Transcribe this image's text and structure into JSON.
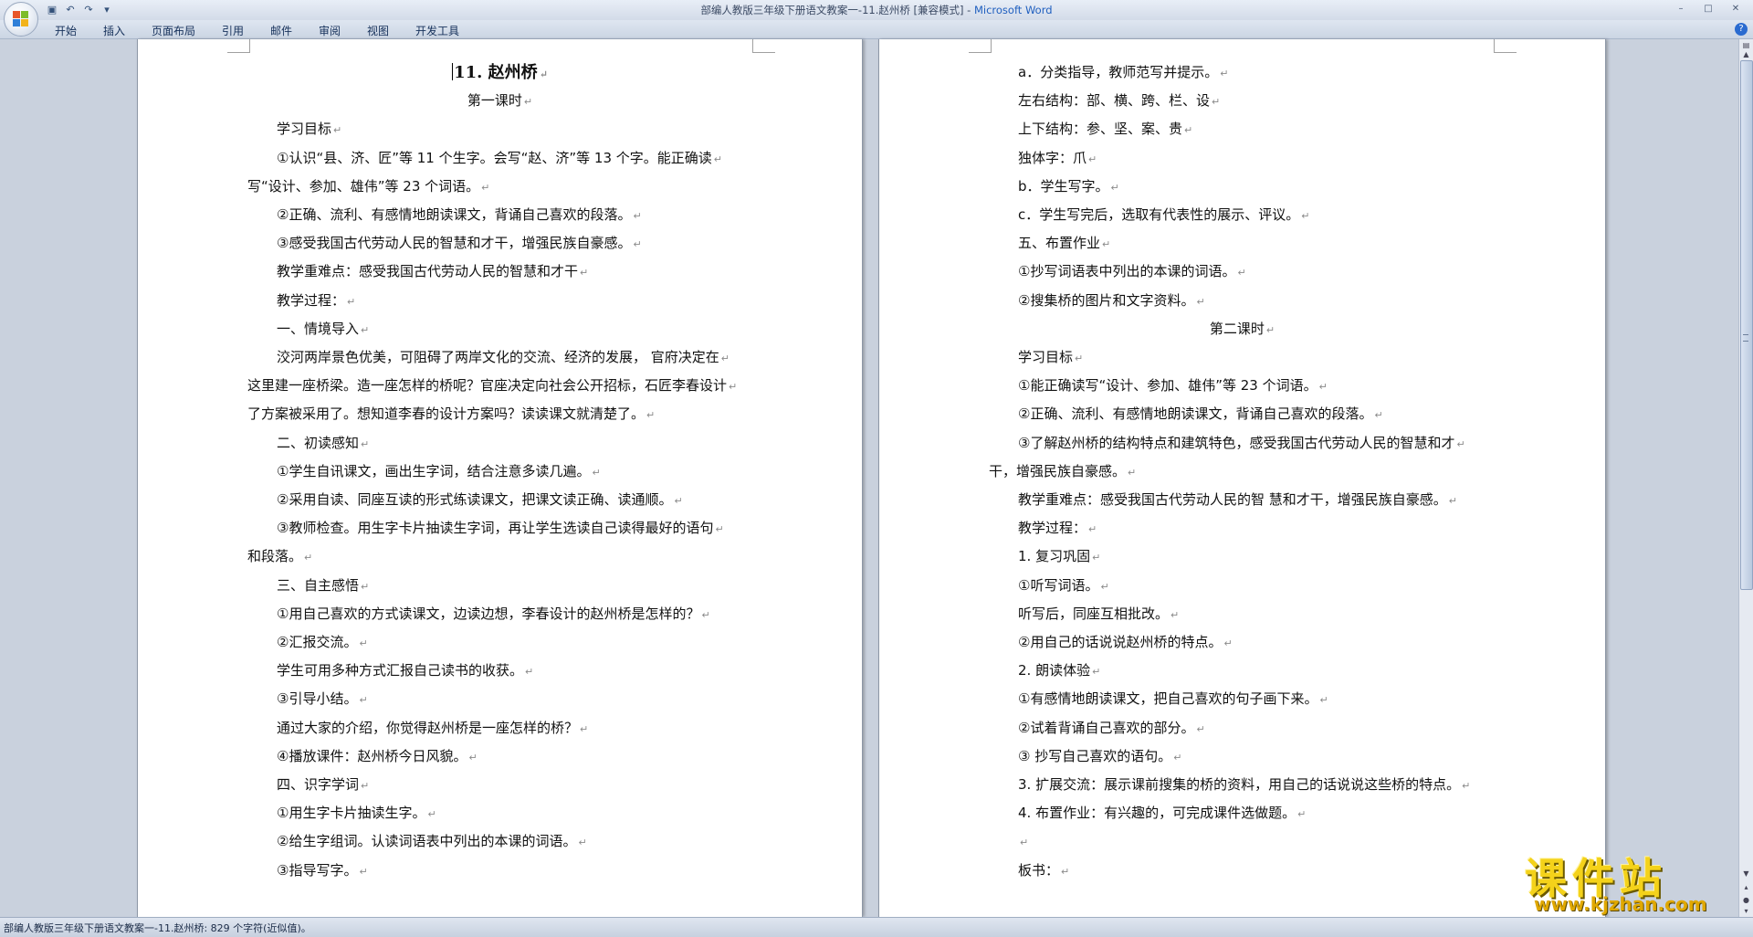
{
  "window": {
    "title_doc": "部编人教版三年级下册语文教案一-11.赵州桥 [兼容模式]",
    "title_sep": " - ",
    "title_app": "Microsoft Word",
    "controls": [
      "–",
      "□",
      "✕"
    ]
  },
  "qat": {
    "items": [
      {
        "icon": "save-icon",
        "glyph": "▣"
      },
      {
        "icon": "undo-icon",
        "glyph": "↶"
      },
      {
        "icon": "redo-icon",
        "glyph": "↷"
      },
      {
        "icon": "customize-icon",
        "glyph": "▾"
      }
    ]
  },
  "ribbon": {
    "tabs": [
      "开始",
      "插入",
      "页面布局",
      "引用",
      "邮件",
      "审阅",
      "视图",
      "开发工具"
    ],
    "help_glyph": "?"
  },
  "left_page": {
    "lines": [
      "11. 赵州桥",
      "第一课时",
      "学习目标",
      "①认识“县、济、匠”等 11 个生字。会写“赵、济”等 13 个字。能正确读",
      "写“设计、参加、雄伟”等 23 个词语。",
      "②正确、流利、有感情地朗读课文，背诵自己喜欢的段落。",
      "③感受我国古代劳动人民的智慧和才干，增强民族自豪感。",
      "教学重难点：感受我国古代劳动人民的智慧和才干",
      "教学过程：",
      "一、情境导入",
      "洨河两岸景色优美，可阻碍了两岸文化的交流、经济的发展， 官府决定在",
      "这里建一座桥梁。造一座怎样的桥呢？官座决定向社会公开招标，石匠李春设计",
      "了方案被采用了。想知道李春的设计方案吗？读读课文就清楚了。",
      "二、初读感知",
      "①学生自讯课文，画出生字词，结合注意多读几遍。",
      "②采用自读、同座互读的形式练读课文，把课文读正确、读通顺。",
      "③教师检查。用生字卡片抽读生字词，再让学生选读自己读得最好的语句",
      "和段落。",
      "三、自主感悟",
      "①用自己喜欢的方式读课文，边读边想，李春设计的赵州桥是怎样的？",
      "②汇报交流。",
      "学生可用多种方式汇报自己读书的收获。",
      "③引导小结。",
      "通过大家的介绍，你觉得赵州桥是一座怎样的桥？",
      "④播放课件：赵州桥今日风貌。",
      "四、识字学词",
      "①用生字卡片抽读生字。",
      "②给生字组词。认读词语表中列出的本课的词语。",
      "③指导写字。"
    ]
  },
  "right_page": {
    "lines": [
      "a．分类指导，教师范写并提示。",
      "左右结构：部、横、跨、栏、设",
      "上下结构：参、坚、案、贵",
      "独体字：爪",
      "b．学生写字。",
      "c．学生写完后，选取有代表性的展示、评议。",
      "五、布置作业",
      "①抄写词语表中列出的本课的词语。",
      "②搜集桥的图片和文字资料。",
      "第二课时",
      "学习目标",
      "①能正确读写“设计、参加、雄伟”等 23 个词语。",
      "②正确、流利、有感情地朗读课文，背诵自己喜欢的段落。",
      "③了解赵州桥的结构特点和建筑特色，感受我国古代劳动人民的智慧和才",
      "干，增强民族自豪感。",
      "教学重难点：感受我国古代劳动人民的智 慧和才干，增强民族自豪感。",
      "教学过程：",
      "1. 复习巩固",
      "①听写词语。",
      "听写后，同座互相批改。",
      "②用自己的话说说赵州桥的特点。",
      "2. 朗读体验",
      "①有感情地朗读课文，把自己喜欢的句子画下来。",
      "②试着背诵自己喜欢的部分。",
      "③ 抄写自己喜欢的语句。",
      "3. 扩展交流：展示课前搜集的桥的资料，用自己的话说说这些桥的特点。",
      "4. 布置作业：有兴趣的，可完成课件选做题。",
      "",
      "板书："
    ]
  },
  "status_bar": {
    "text": "部编人教版三年级下册语文教案一-11.赵州桥: 829 个字符(近似值)。"
  },
  "watermark": {
    "logo_text": "课件站",
    "url": "www.kjzhan.com"
  },
  "colors": {
    "ribbon_tab_text": "#15305a",
    "app_name": "#1f5fbf",
    "watermark": "#f4d21a"
  }
}
